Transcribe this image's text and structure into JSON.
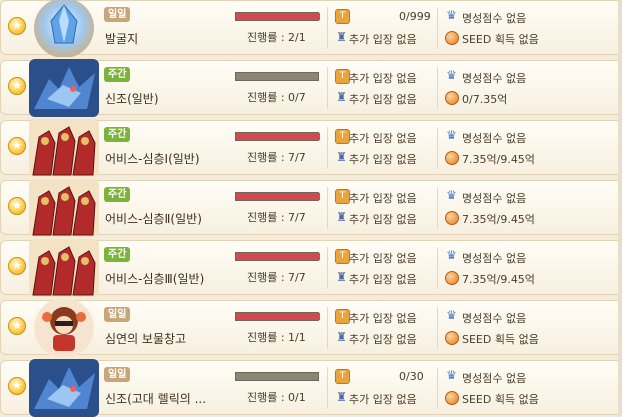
{
  "rows": [
    {
      "badge": "일일",
      "badge_type": "daily",
      "name": "발굴지",
      "progress_text": "진행률 : 2/1",
      "progress_fraction": 1.0,
      "ticket_count": "0/999",
      "extra_entry": "추가 입장 없음",
      "fame": "명성점수 없음",
      "seed": "SEED 획득 없음",
      "thumb": "crystal"
    },
    {
      "badge": "주간",
      "badge_type": "weekly",
      "name": "신조(일반)",
      "progress_text": "진행률 : 0/7",
      "progress_fraction": 0.0,
      "ticket_count": "",
      "ticket_entry": "추가 입장 없음",
      "extra_entry": "추가 입장 없음",
      "fame": "명성점수 없음",
      "seed": "0/7.35억",
      "thumb": "dragon"
    },
    {
      "badge": "주간",
      "badge_type": "weekly",
      "name": "어비스-심층Ⅰ(일반)",
      "progress_text": "진행률 : 7/7",
      "progress_fraction": 1.0,
      "ticket_count": "",
      "ticket_entry": "추가 입장 없음",
      "extra_entry": "추가 입장 없음",
      "fame": "명성점수 없음",
      "seed": "7.35억/9.45억",
      "thumb": "knights"
    },
    {
      "badge": "주간",
      "badge_type": "weekly",
      "name": "어비스-심층Ⅱ(일반)",
      "progress_text": "진행률 : 7/7",
      "progress_fraction": 1.0,
      "ticket_count": "",
      "ticket_entry": "추가 입장 없음",
      "extra_entry": "추가 입장 없음",
      "fame": "명성점수 없음",
      "seed": "7.35억/9.45억",
      "thumb": "knights"
    },
    {
      "badge": "주간",
      "badge_type": "weekly",
      "name": "어비스-심층Ⅲ(일반)",
      "progress_text": "진행률 : 7/7",
      "progress_fraction": 1.0,
      "ticket_count": "",
      "ticket_entry": "추가 입장 없음",
      "extra_entry": "추가 입장 없음",
      "fame": "명성점수 없음",
      "seed": "7.35억/9.45억",
      "thumb": "knights"
    },
    {
      "badge": "일일",
      "badge_type": "daily",
      "name": "심연의 보물창고",
      "progress_text": "진행률 : 1/1",
      "progress_fraction": 1.0,
      "ticket_count": "",
      "ticket_entry": "추가 입장 없음",
      "extra_entry": "추가 입장 없음",
      "fame": "명성점수 없음",
      "seed": "SEED 획득 없음",
      "thumb": "girl"
    },
    {
      "badge": "일일",
      "badge_type": "daily",
      "name": "신조(고대 렐릭의 ...",
      "progress_text": "진행률 : 0/1",
      "progress_fraction": 0.0,
      "ticket_count": "0/30",
      "extra_entry": "추가 입장 없음",
      "fame": "명성점수 없음",
      "seed": "SEED 획득 없음",
      "thumb": "dragon"
    }
  ],
  "colors": {
    "bar_fill": "#d24a4f",
    "bar_empty": "#8c8574",
    "badge_daily": "#c9a679",
    "badge_weekly": "#7cb33c"
  }
}
